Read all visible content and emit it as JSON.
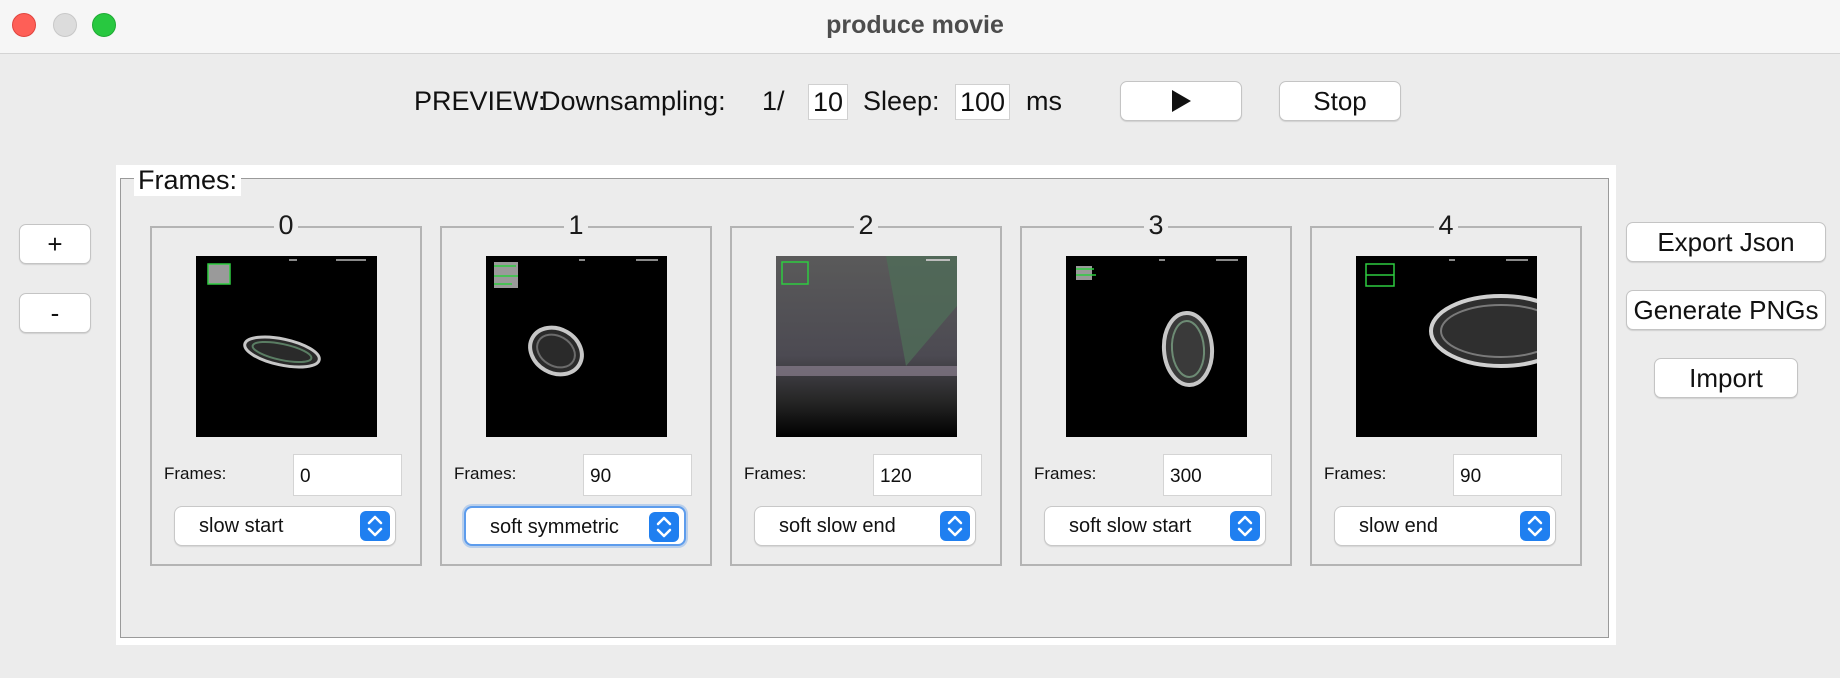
{
  "window": {
    "title": "produce movie"
  },
  "preview": {
    "label": "PREVIEW:",
    "downsampling_label": "Downsampling:",
    "downsampling_prefix": "1/",
    "downsampling_value": "10",
    "sleep_label": "Sleep:",
    "sleep_value": "100",
    "sleep_unit": "ms",
    "stop_label": "Stop"
  },
  "left_buttons": {
    "add_label": "+",
    "remove_label": "-"
  },
  "frames_panel": {
    "legend": "Frames:",
    "cards": [
      {
        "index": "0",
        "frames_label": "Frames:",
        "frames_value": "0",
        "easing": "slow start"
      },
      {
        "index": "1",
        "frames_label": "Frames:",
        "frames_value": "90",
        "easing": "soft symmetric"
      },
      {
        "index": "2",
        "frames_label": "Frames:",
        "frames_value": "120",
        "easing": "soft slow end"
      },
      {
        "index": "3",
        "frames_label": "Frames:",
        "frames_value": "300",
        "easing": "soft slow start"
      },
      {
        "index": "4",
        "frames_label": "Frames:",
        "frames_value": "90",
        "easing": "slow end"
      }
    ]
  },
  "right_buttons": {
    "export_label": "Export Json",
    "generate_label": "Generate PNGs",
    "import_label": "Import"
  },
  "colors": {
    "accent": "#1f7ff0",
    "close": "#fe5f57",
    "maximize": "#28c840"
  }
}
